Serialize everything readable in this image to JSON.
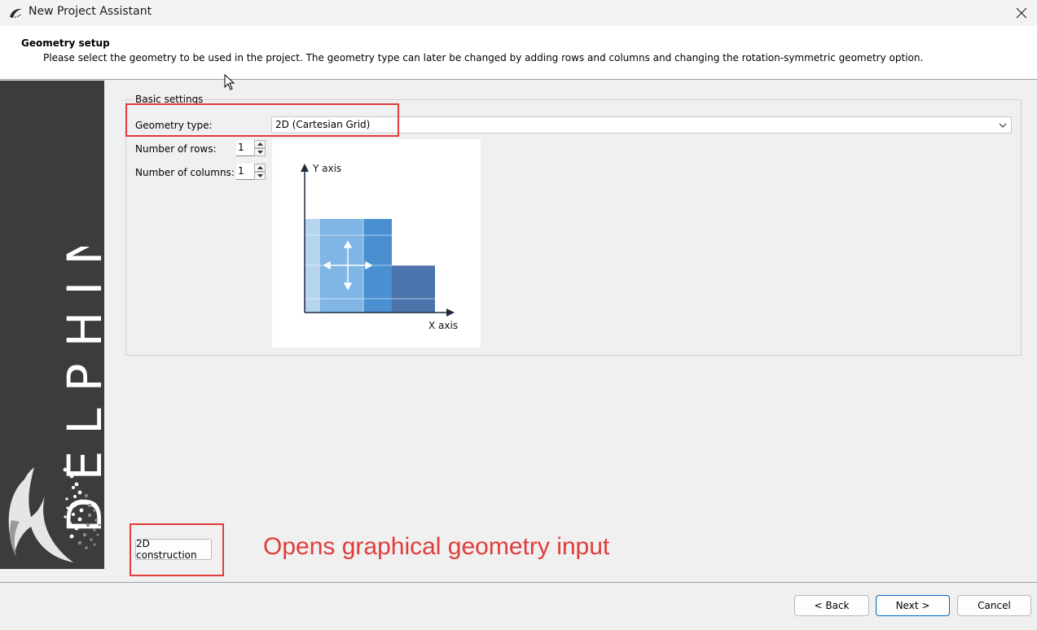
{
  "window": {
    "title": "New Project Assistant",
    "icon": "delphin-app-icon",
    "close_icon": "close-icon"
  },
  "header": {
    "title": "Geometry setup",
    "description": "Please select the geometry to be used in the project. The geometry type can later be changed by adding rows and columns and changing the rotation-symmetric geometry option."
  },
  "sidebar": {
    "brand": "DELPHIN"
  },
  "basic_settings": {
    "group_title": "Basic settings",
    "geometry_type_label": "Geometry type:",
    "geometry_type_value": "2D (Cartesian Grid)",
    "rows_label": "Number of rows:",
    "rows_value": "1",
    "columns_label": "Number of columns:",
    "columns_value": "1"
  },
  "preview": {
    "y_axis_label": "Y axis",
    "x_axis_label": "X axis",
    "colors": {
      "light": "#b5d5ef",
      "medium": "#7fb6e6",
      "strong": "#4a8fd0",
      "dark": "#4a74ab"
    }
  },
  "construction_button": "2D construction",
  "annotation": {
    "text": "Opens graphical geometry input",
    "color": "#e03c3c"
  },
  "footer": {
    "back": "< Back",
    "next": "Next >",
    "cancel": "Cancel"
  }
}
